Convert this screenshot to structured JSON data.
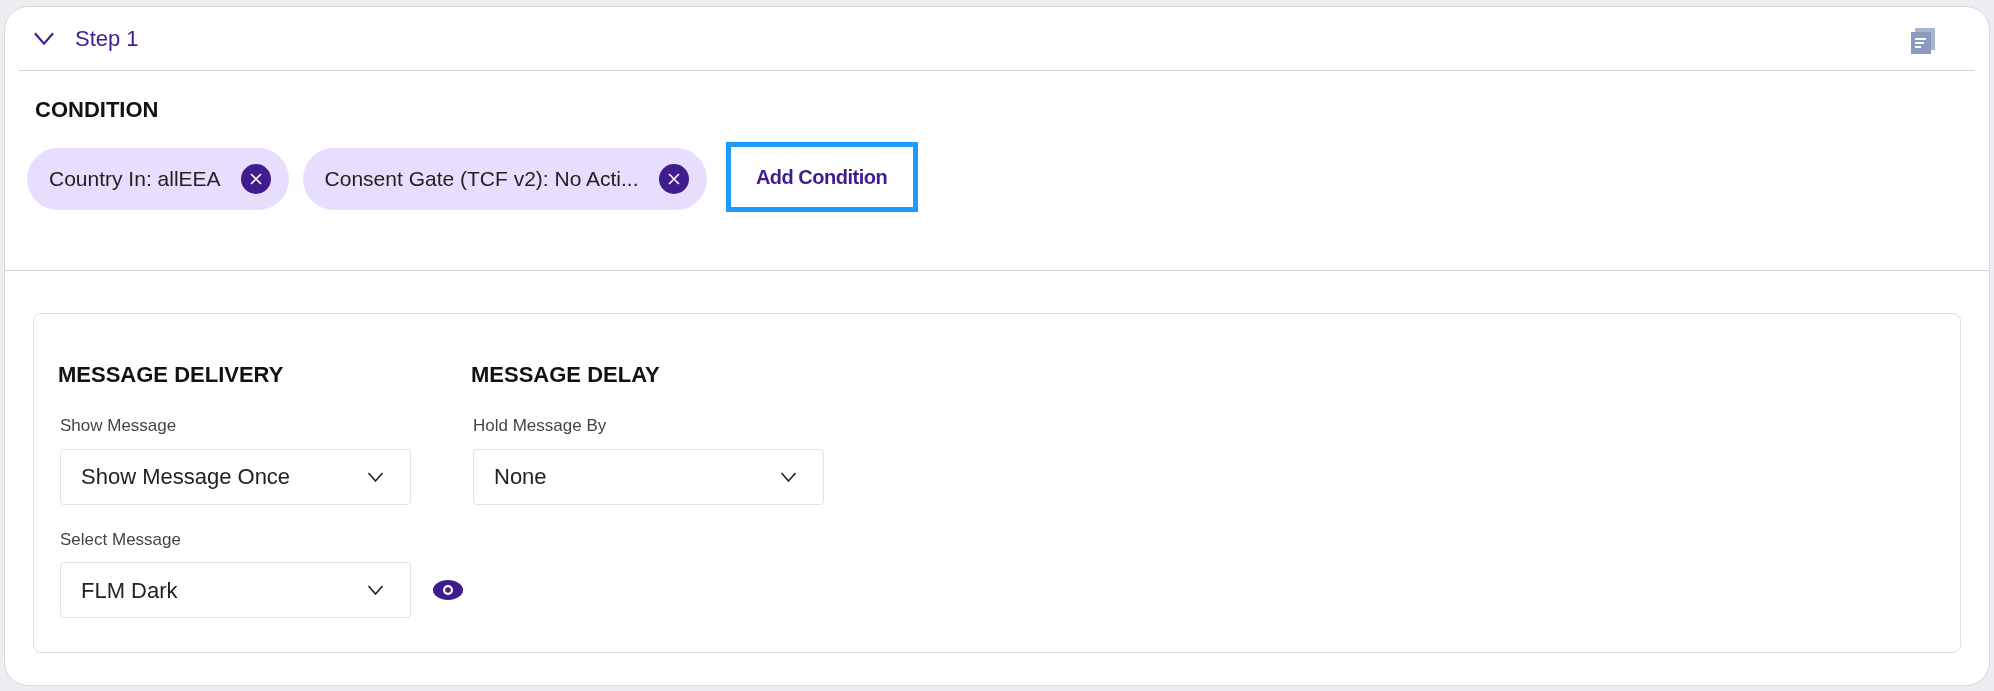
{
  "step": {
    "title": "Step 1",
    "expanded": true
  },
  "condition": {
    "heading": "CONDITION",
    "chips": [
      {
        "label": "Country In: allEEA"
      },
      {
        "label": "Consent Gate (TCF v2): No Acti..."
      }
    ],
    "add_button": "Add Condition"
  },
  "delivery": {
    "heading": "MESSAGE DELIVERY",
    "fields": [
      {
        "label": "Show Message",
        "value": "Show Message Once",
        "preview": false
      },
      {
        "label": "Select Message",
        "value": "FLM Dark",
        "preview": true
      }
    ]
  },
  "delay": {
    "heading": "MESSAGE DELAY",
    "fields": [
      {
        "label": "Hold Message By",
        "value": "None",
        "preview": false
      }
    ]
  }
}
